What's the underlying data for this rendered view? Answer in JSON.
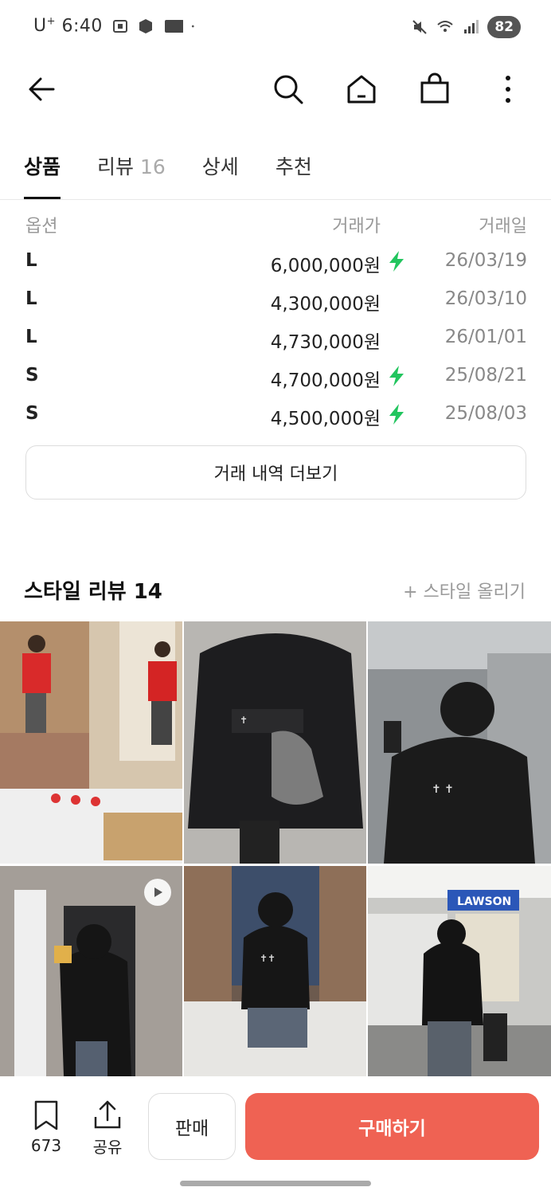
{
  "status_bar": {
    "carrier": "U",
    "carrier_sup": "+",
    "time": "6:40",
    "battery": "82"
  },
  "tabs": [
    {
      "label": "상품",
      "count": ""
    },
    {
      "label": "리뷰",
      "count": "16"
    },
    {
      "label": "상세",
      "count": ""
    },
    {
      "label": "추천",
      "count": ""
    }
  ],
  "transactions": {
    "headers": {
      "option": "옵션",
      "price": "거래가",
      "date": "거래일"
    },
    "rows": [
      {
        "option": "L",
        "price": "6,000,000원",
        "fast": true,
        "date": "26/03/19"
      },
      {
        "option": "L",
        "price": "4,300,000원",
        "fast": false,
        "date": "26/03/10"
      },
      {
        "option": "L",
        "price": "4,730,000원",
        "fast": false,
        "date": "26/01/01"
      },
      {
        "option": "S",
        "price": "4,700,000원",
        "fast": true,
        "date": "25/08/21"
      },
      {
        "option": "S",
        "price": "4,500,000원",
        "fast": true,
        "date": "25/08/03"
      }
    ],
    "more_label": "거래 내역 더보기"
  },
  "style_review": {
    "title": "스타일 리뷰 14",
    "upload_label": "+ 스타일 올리기"
  },
  "bottom_bar": {
    "bookmark_count": "673",
    "share_label": "공유",
    "sell_label": "판매",
    "buy_label": "구매하기"
  },
  "colors": {
    "buy_button": "#ef6253",
    "fast_bolt": "#22c55e",
    "muted_text": "#999999"
  }
}
